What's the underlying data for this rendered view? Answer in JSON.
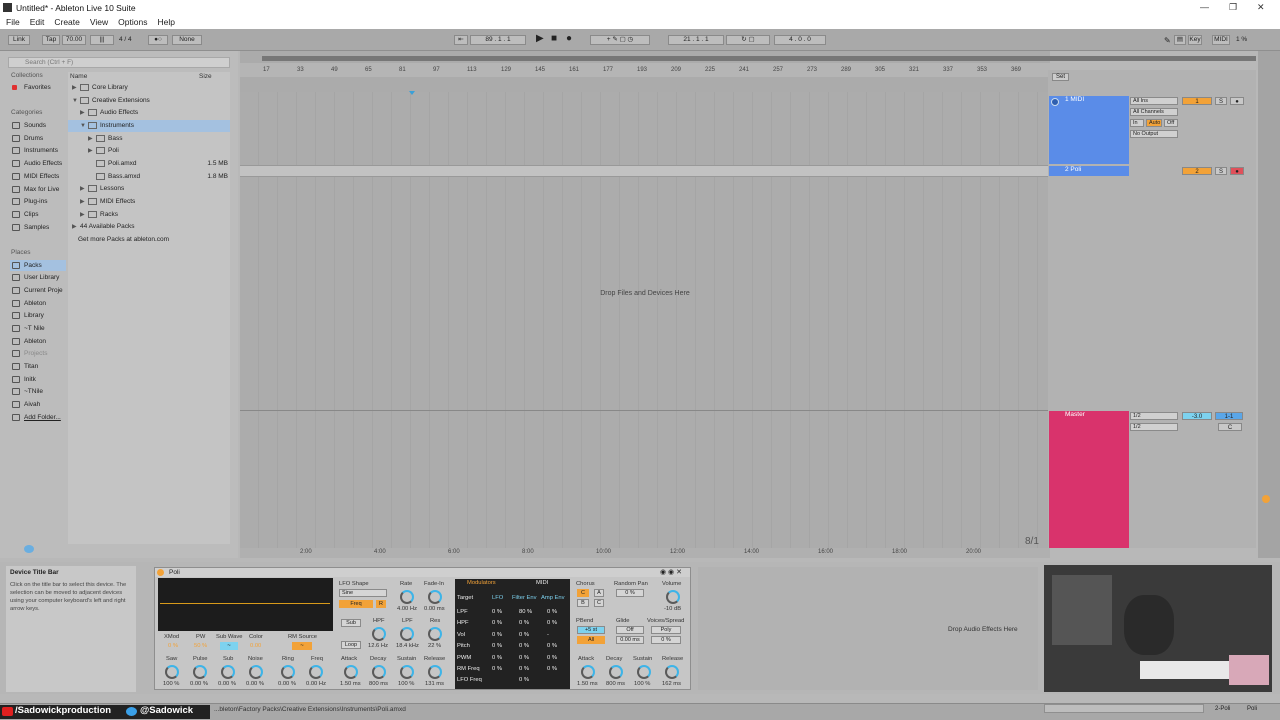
{
  "window": {
    "title": "Untitled* - Ableton Live 10 Suite"
  },
  "menu": [
    "File",
    "Edit",
    "Create",
    "View",
    "Options",
    "Help"
  ],
  "control_bar": {
    "link": "Link",
    "tap": "Tap",
    "tempo": "70.00",
    "signature": "4 / 4",
    "quantize": "None",
    "arr_position": "89 . 1 . 1",
    "loop_start": "21 . 1 . 1",
    "loop_length": "4 . 0 . 0",
    "key": "Key",
    "midi": "MIDI",
    "cpu": "1 %"
  },
  "browser": {
    "search_placeholder": "Search (Ctrl + F)",
    "collections_label": "Collections",
    "favorites": "Favorites",
    "categories_label": "Categories",
    "categories": [
      "Sounds",
      "Drums",
      "Instruments",
      "Audio Effects",
      "MIDI Effects",
      "Max for Live",
      "Plug-ins",
      "Clips",
      "Samples"
    ],
    "places_label": "Places",
    "places": [
      "Packs",
      "User Library",
      "Current Proje",
      "Ableton",
      "Library",
      "~T Nile",
      "Ableton",
      "Projects",
      "Titan",
      "Initk",
      "~TNile",
      "Aivah",
      "Add Folder..."
    ],
    "col_name": "Name",
    "col_size": "Size",
    "files": [
      {
        "name": "Core Library",
        "size": ""
      },
      {
        "name": "Creative Extensions",
        "size": ""
      },
      {
        "name": "Audio Effects",
        "size": ""
      },
      {
        "name": "Instruments",
        "size": ""
      },
      {
        "name": "Bass",
        "size": ""
      },
      {
        "name": "Poli",
        "size": ""
      },
      {
        "name": "Poli.amxd",
        "size": "1.5 MB"
      },
      {
        "name": "Bass.amxd",
        "size": "1.8 MB"
      },
      {
        "name": "Lessons",
        "size": ""
      },
      {
        "name": "MIDI Effects",
        "size": ""
      },
      {
        "name": "Racks",
        "size": ""
      },
      {
        "name": "44 Available Packs",
        "size": ""
      },
      {
        "name": "Get more Packs at ableton.com",
        "size": ""
      }
    ]
  },
  "arrangement": {
    "ruler": [
      "17",
      "33",
      "49",
      "65",
      "81",
      "97",
      "113",
      "129",
      "145",
      "161",
      "177",
      "193",
      "209",
      "225",
      "241",
      "257",
      "273",
      "289",
      "305",
      "321",
      "337",
      "353",
      "369"
    ],
    "drop_text": "Drop Files and Devices Here",
    "time": [
      "2:00",
      "4:00",
      "6:00",
      "8:00",
      "10:00",
      "12:00",
      "14:00",
      "16:00",
      "18:00",
      "20:00"
    ],
    "counter": "8/1",
    "set_label": "Set"
  },
  "tracks": [
    {
      "name": "1 MIDI",
      "color": "#5a8ce8",
      "input": "All Ins",
      "channel": "All Channels",
      "monitor": [
        "In",
        "Auto",
        "Off"
      ],
      "output": "No Output",
      "number": "1",
      "solo": "S"
    },
    {
      "name": "2 Poli",
      "color": "#5a8ce8",
      "number": "2",
      "solo": "S"
    }
  ],
  "master": {
    "name": "Master",
    "color": "#d9336c",
    "in1": "1/2",
    "in2": "1/2",
    "volume": "-3.0",
    "pan": "1-1",
    "c": "C"
  },
  "info": {
    "title": "Device Title Bar",
    "body": "Click on the title bar to select this device. The selection can be moved to adjacent devices using your computer keyboard's left and right arrow keys."
  },
  "device": {
    "name": "Poli",
    "lfo_shape_label": "LFO Shape",
    "lfo_shape": "Sine",
    "rate_label": "Rate",
    "rate": "4.00 Hz",
    "fadein_label": "Fade-In",
    "fadein": "0.00 ms",
    "freq_btn": "Freq",
    "r_btn": "R",
    "sub_btn": "Sub",
    "loop_btn": "Loop",
    "hpf_label": "HPF",
    "hpf": "12.6 Hz",
    "lpf_label": "LPF",
    "lpf": "18.4 kHz",
    "res_label": "Res",
    "res": "22 %",
    "osc_params": [
      {
        "label": "XMod",
        "value": "0 %"
      },
      {
        "label": "PW",
        "value": "50 %"
      },
      {
        "label": "Sub Wave",
        "value": ""
      },
      {
        "label": "Color",
        "value": "0.00"
      },
      {
        "label": "RM Source",
        "value": ""
      }
    ],
    "mix": [
      {
        "label": "Saw",
        "value": "100 %"
      },
      {
        "label": "Pulse",
        "value": "0.00 %"
      },
      {
        "label": "Sub",
        "value": "0.00 %"
      },
      {
        "label": "Noise",
        "value": "0.00 %"
      },
      {
        "label": "Ring",
        "value": "0.00 %"
      },
      {
        "label": "Freq",
        "value": "0.00 Hz"
      }
    ],
    "filter_env": [
      {
        "label": "Attack",
        "value": "1.50 ms"
      },
      {
        "label": "Decay",
        "value": "800 ms"
      },
      {
        "label": "Sustain",
        "value": "100 %"
      },
      {
        "label": "Release",
        "value": "131 ms"
      }
    ],
    "modulators": {
      "tab1": "Modulators",
      "tab2": "MIDI",
      "header": [
        "Target",
        "LFO",
        "Filter Env",
        "Amp Env"
      ],
      "rows": [
        {
          "t": "LPF",
          "a": "0 %",
          "b": "80 %",
          "c": "0 %"
        },
        {
          "t": "HPF",
          "a": "0 %",
          "b": "0 %",
          "c": "0 %"
        },
        {
          "t": "Vol",
          "a": "0 %",
          "b": "0 %",
          "c": "-"
        },
        {
          "t": "Pitch",
          "a": "0 %",
          "b": "0 %",
          "c": "0 %"
        },
        {
          "t": "PWM",
          "a": "0 %",
          "b": "0 %",
          "c": "0 %"
        },
        {
          "t": "RM Freq",
          "a": "0 %",
          "b": "0 %",
          "c": "0 %"
        },
        {
          "t": "LFO Freq",
          "a": "",
          "b": "0 %",
          "c": ""
        }
      ]
    },
    "chorus_label": "Chorus",
    "chorus_a": "A",
    "chorus_b": "B",
    "chorus_c": "C",
    "random_pan_label": "Random Pan",
    "random_pan": "0 %",
    "volume_label": "Volume",
    "volume": "-10 dB",
    "pbend_label": "PBend",
    "pbend": "+5 st",
    "all_btn": "All",
    "glide_label": "Glide",
    "glide": "Off",
    "glide_time": "0.00 ms",
    "voices_label": "Voices/Spread",
    "voices": "Poly",
    "spread": "0 %",
    "amp_env": [
      {
        "label": "Attack",
        "value": "1.50 ms"
      },
      {
        "label": "Decay",
        "value": "800 ms"
      },
      {
        "label": "Sustain",
        "value": "100 %"
      },
      {
        "label": "Release",
        "value": "162 ms"
      }
    ]
  },
  "fx_drop": "Drop Audio Effects Here",
  "status": {
    "path": "...bleton\\Factory Packs\\Creative Extensions\\Instruments\\Poli.amxd",
    "track": "2-Poli",
    "device": "Poli"
  },
  "overlay": {
    "youtube": "/Sadowickproduction",
    "twitter": "@Sadowick"
  }
}
